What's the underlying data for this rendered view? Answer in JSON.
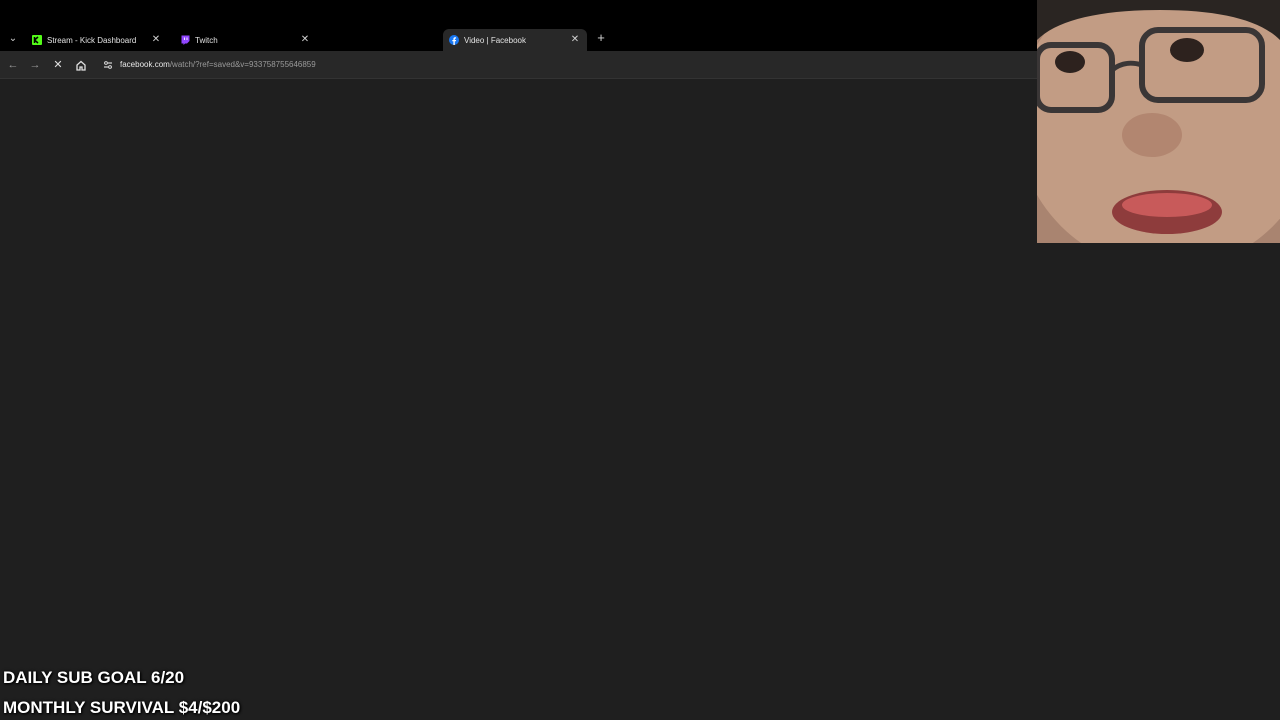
{
  "browser": {
    "tabs": [
      {
        "title": "Stream - Kick Dashboard",
        "icon": "kick-icon",
        "active": false
      },
      {
        "title": "Twitch",
        "icon": "twitch-icon",
        "active": false
      },
      {
        "title": "Video | Facebook",
        "icon": "facebook-icon",
        "active": true
      }
    ],
    "url_host": "facebook.com",
    "url_path": "/watch/?ref=saved&v=933758755646859"
  },
  "overlay": {
    "daily_goal": "DAILY SUB GOAL 6/20",
    "monthly_goal": "MONTHLY SURVIVAL $4/$200"
  },
  "colors": {
    "kick": "#53fc18",
    "twitch": "#9146ff",
    "facebook": "#1877f2"
  }
}
